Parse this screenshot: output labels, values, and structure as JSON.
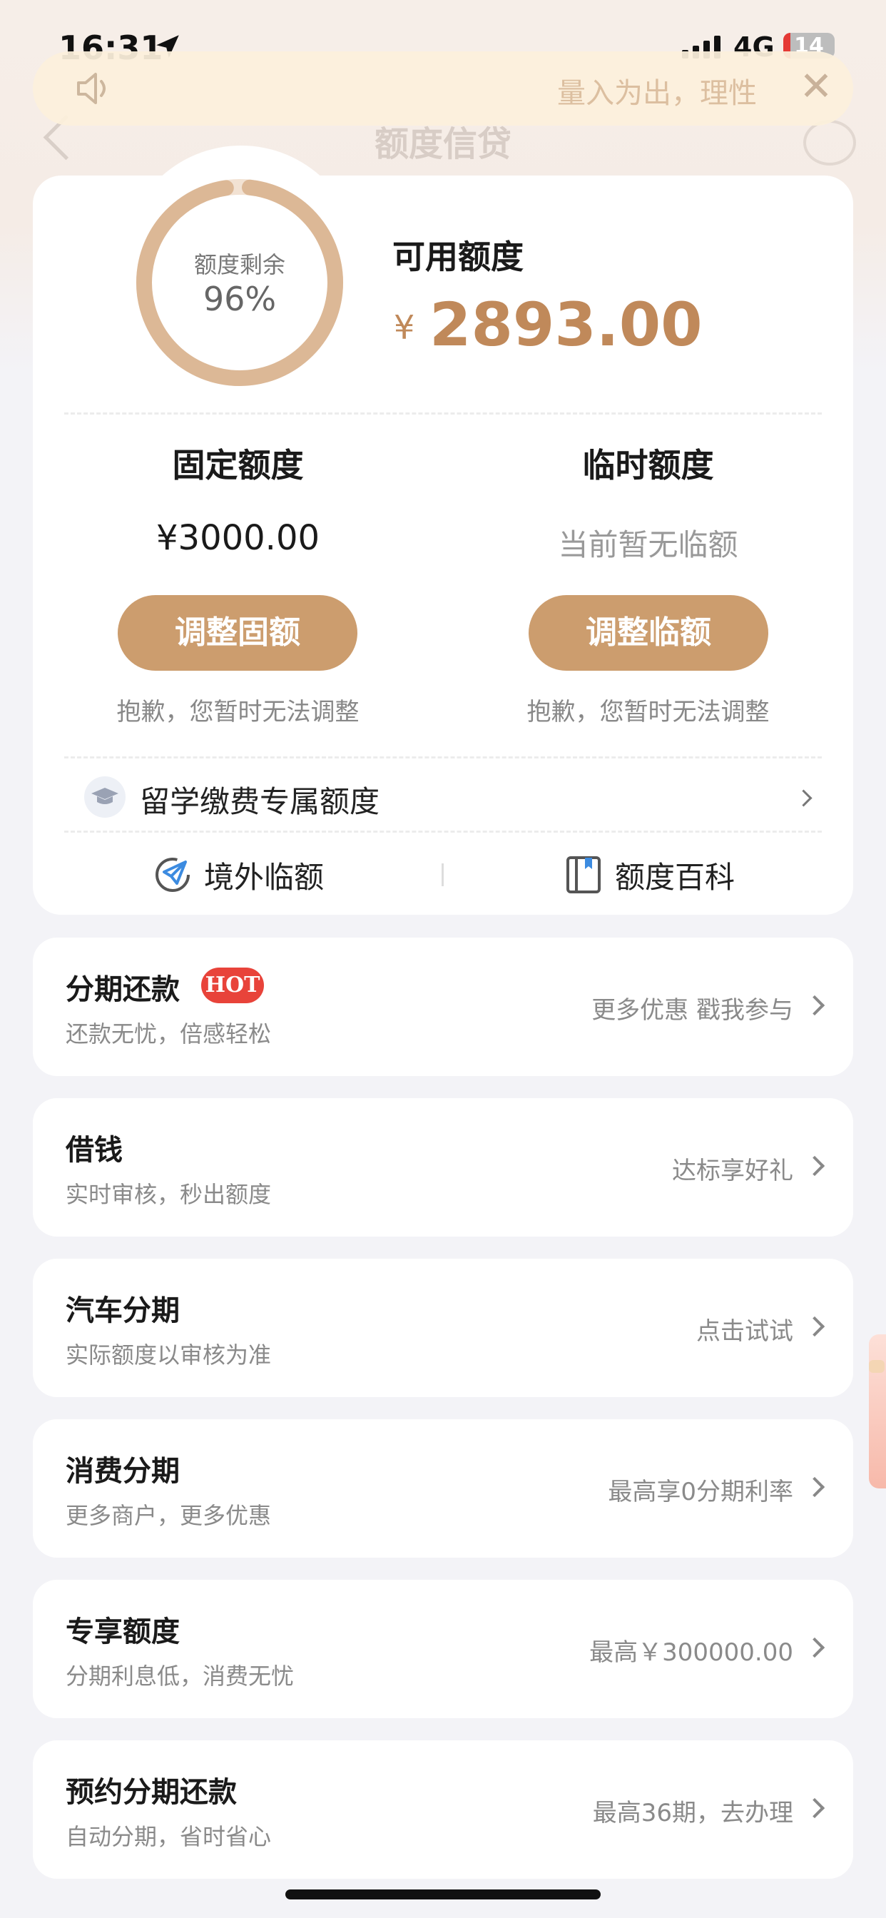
{
  "status_bar": {
    "time": "16:31",
    "network": "4G",
    "battery": "14",
    "battery_level": 0.14
  },
  "notice": {
    "text": "量入为出，理性"
  },
  "nav": {
    "title": "额度信贷"
  },
  "credit": {
    "remaining_label": "额度剩余",
    "remaining_percent": "96%",
    "remaining_fraction": 0.96,
    "available_label": "可用额度",
    "currency_symbol": "¥",
    "available_amount": "2893.00",
    "fixed": {
      "title": "固定额度",
      "value": "¥3000.00",
      "button": "调整固额",
      "note": "抱歉，您暂时无法调整"
    },
    "temporary": {
      "title": "临时额度",
      "value": "当前暂无临额",
      "button": "调整临额",
      "note": "抱歉，您暂时无法调整"
    },
    "study_abroad_label": "留学缴费专属额度",
    "links": {
      "overseas": "境外临额",
      "encyclopedia": "额度百科"
    }
  },
  "colors": {
    "accent": "#cc9d6e",
    "amount": "#c0895a",
    "hot_badge": "#e8433a"
  },
  "rows": [
    {
      "title": "分期还款",
      "badge": "HOT",
      "subtitle": "还款无忧，倍感轻松",
      "right": "更多优惠 戳我参与"
    },
    {
      "title": "借钱",
      "subtitle": "实时审核，秒出额度",
      "right": "达标享好礼"
    },
    {
      "title": "汽车分期",
      "subtitle": "实际额度以审核为准",
      "right": "点击试试"
    },
    {
      "title": "消费分期",
      "subtitle": "更多商户，更多优惠",
      "right": "最高享0分期利率"
    },
    {
      "title": "专享额度",
      "subtitle": "分期利息低，消费无忧",
      "right": "最高￥300000.00"
    },
    {
      "title": "预约分期还款",
      "subtitle": "自动分期，省时省心",
      "right": "最高36期，去办理"
    }
  ]
}
